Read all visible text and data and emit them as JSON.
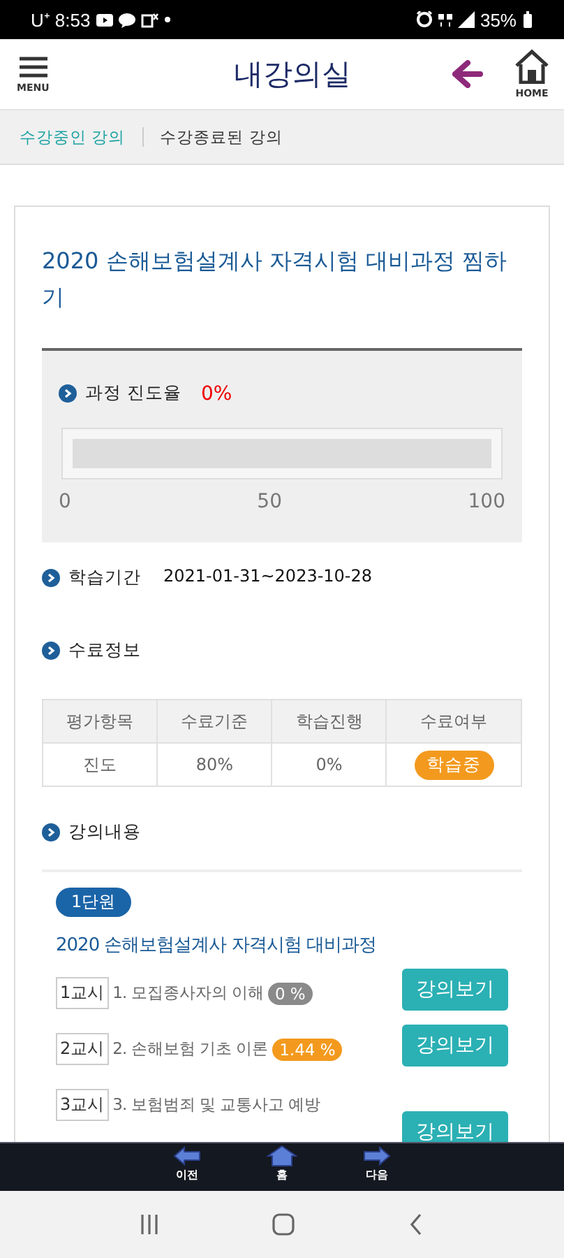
{
  "status_bar": {
    "carrier": "U⁺",
    "time": "8:53",
    "battery": "35%"
  },
  "header": {
    "menu_label": "MENU",
    "title": "내강의실",
    "home_label": "HOME"
  },
  "tabs": [
    {
      "label": "수강중인 강의",
      "selected": true
    },
    {
      "label": "수강종료된 강의",
      "selected": false
    }
  ],
  "course": {
    "title": "2020 손해보험설계사 자격시험 대비과정  찜하기",
    "progress": {
      "label": "과정 진도율",
      "value": "0%",
      "level": 0,
      "scale": [
        "0",
        "50",
        "100"
      ]
    },
    "period": {
      "label": "학습기간",
      "value": "2021-01-31~2023-10-28"
    },
    "completion": {
      "label": "수료정보",
      "columns": [
        "평가항목",
        "수료기준",
        "학습진행",
        "수료여부"
      ],
      "rows": [
        {
          "item": "진도",
          "criterion": "80%",
          "progress": "0%",
          "status": "학습중"
        }
      ]
    },
    "contents": {
      "label": "강의내용",
      "unit": "1단원",
      "unit_title": "2020 손해보험설계사 자격시험 대비과정",
      "lessons": [
        {
          "period": "1교시",
          "title": "1. 모집종사자의 이해",
          "percent": "0 %",
          "color": "#8a8a8a",
          "button": "강의보기"
        },
        {
          "period": "2교시",
          "title": "2. 손해보험 기초 이론",
          "percent": "1.44 %",
          "color": "#f39a1e",
          "button": "강의보기"
        },
        {
          "period": "3교시",
          "title": "3. 보험범죄 및 교통사고 예방",
          "button": "강의보기"
        }
      ]
    }
  },
  "bottom_nav": [
    {
      "kind": "back",
      "label": "이전"
    },
    {
      "kind": "home",
      "label": "홈"
    },
    {
      "kind": "forward",
      "label": "다음"
    }
  ]
}
